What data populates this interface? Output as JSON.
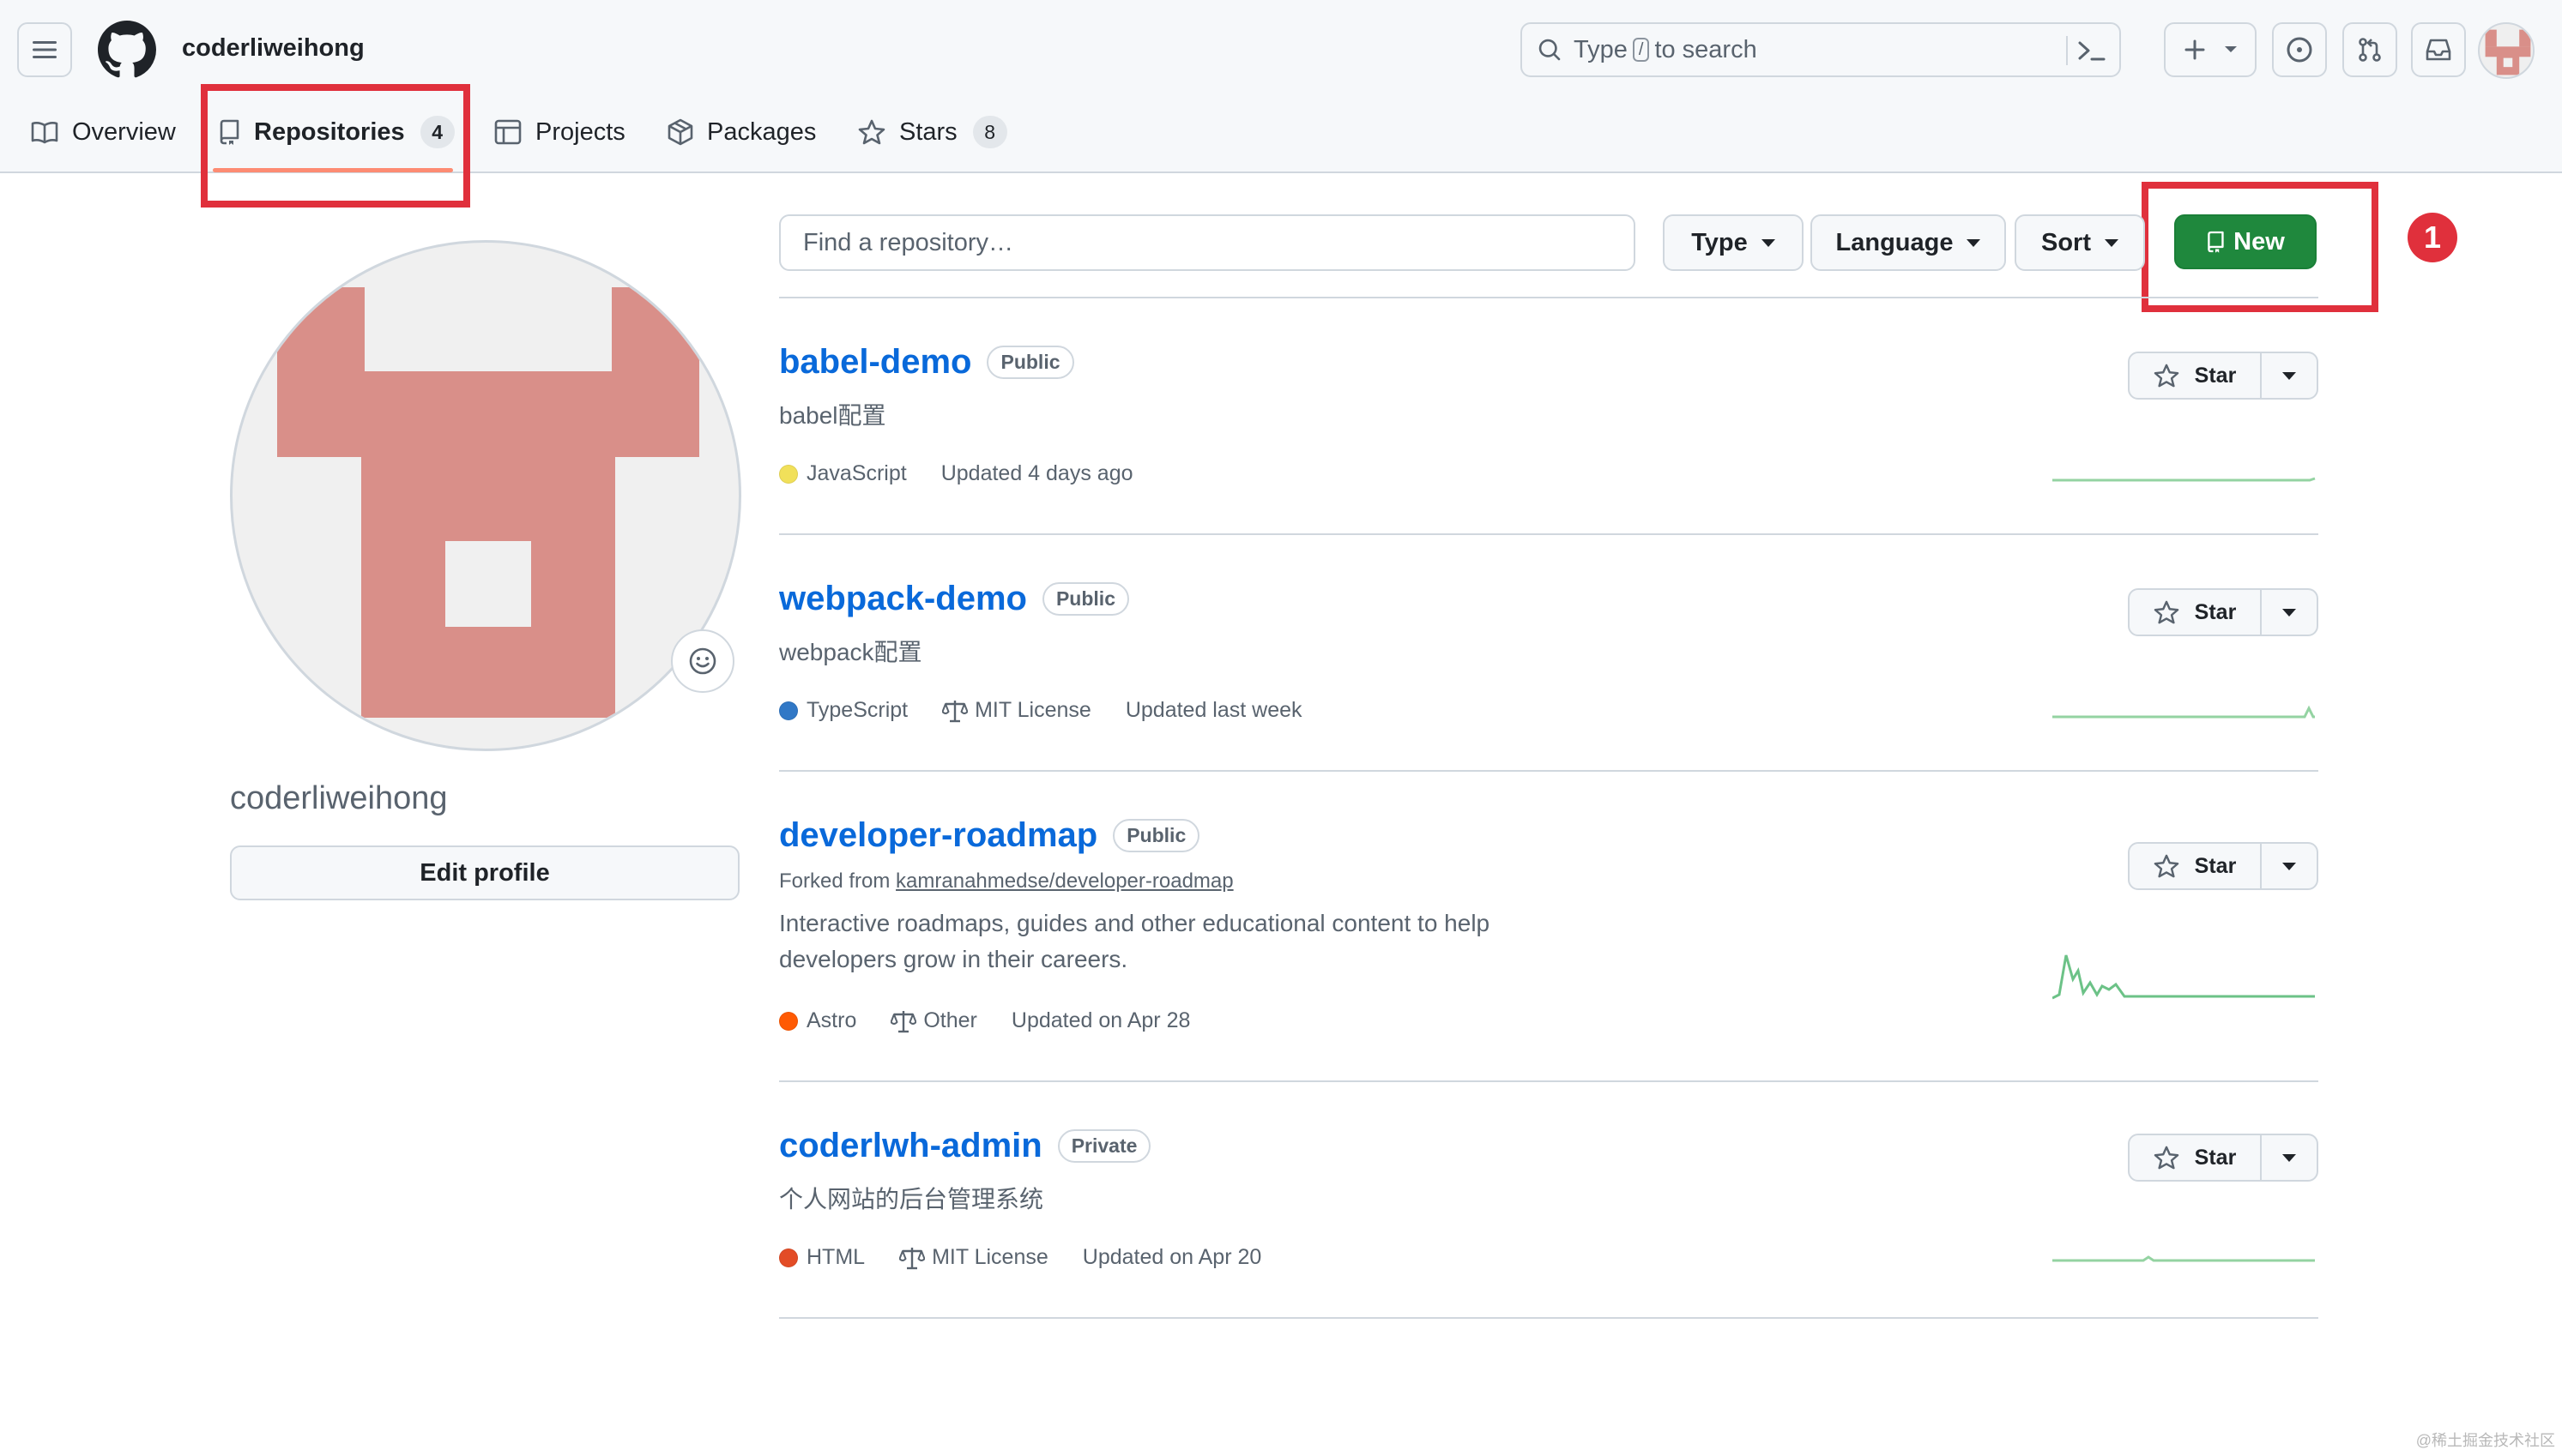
{
  "header": {
    "username": "coderliweihong",
    "search": {
      "prefix": "Type",
      "key": "/",
      "suffix": "to search"
    }
  },
  "tabs": [
    {
      "label": "Overview"
    },
    {
      "label": "Repositories",
      "count": "4"
    },
    {
      "label": "Projects"
    },
    {
      "label": "Packages"
    },
    {
      "label": "Stars",
      "count": "8"
    }
  ],
  "annotation": {
    "number": "1"
  },
  "profile": {
    "name": "coderliweihong",
    "edit_label": "Edit profile"
  },
  "toolbar": {
    "find_placeholder": "Find a repository…",
    "type_label": "Type",
    "language_label": "Language",
    "sort_label": "Sort",
    "new_label": "New"
  },
  "repos": [
    {
      "name": "babel-demo",
      "visibility": "Public",
      "description": "babel配置",
      "language": "JavaScript",
      "language_color": "#f1e05a",
      "updated": "Updated 4 days ago",
      "star_label": "Star"
    },
    {
      "name": "webpack-demo",
      "visibility": "Public",
      "description": "webpack配置",
      "language": "TypeScript",
      "language_color": "#3178c6",
      "license": "MIT License",
      "updated": "Updated last week",
      "star_label": "Star"
    },
    {
      "name": "developer-roadmap",
      "visibility": "Public",
      "forked_prefix": "Forked from",
      "forked_from": "kamranahmedse/developer-roadmap",
      "description": "Interactive roadmaps, guides and other educational content to help developers grow in their careers.",
      "language": "Astro",
      "language_color": "#ff5a03",
      "license": "Other",
      "updated": "Updated on Apr 28",
      "star_label": "Star"
    },
    {
      "name": "coderlwh-admin",
      "visibility": "Private",
      "description": "个人网站的后台管理系统",
      "language": "HTML",
      "language_color": "#e34c26",
      "license": "MIT License",
      "updated": "Updated on Apr 20",
      "star_label": "Star"
    }
  ],
  "colors": {
    "accent": "#0969da",
    "new_button": "#1f883d",
    "annotation": "#e0303c",
    "tab_underline": "#fd8c73"
  },
  "watermark": "@稀土掘金技术社区"
}
